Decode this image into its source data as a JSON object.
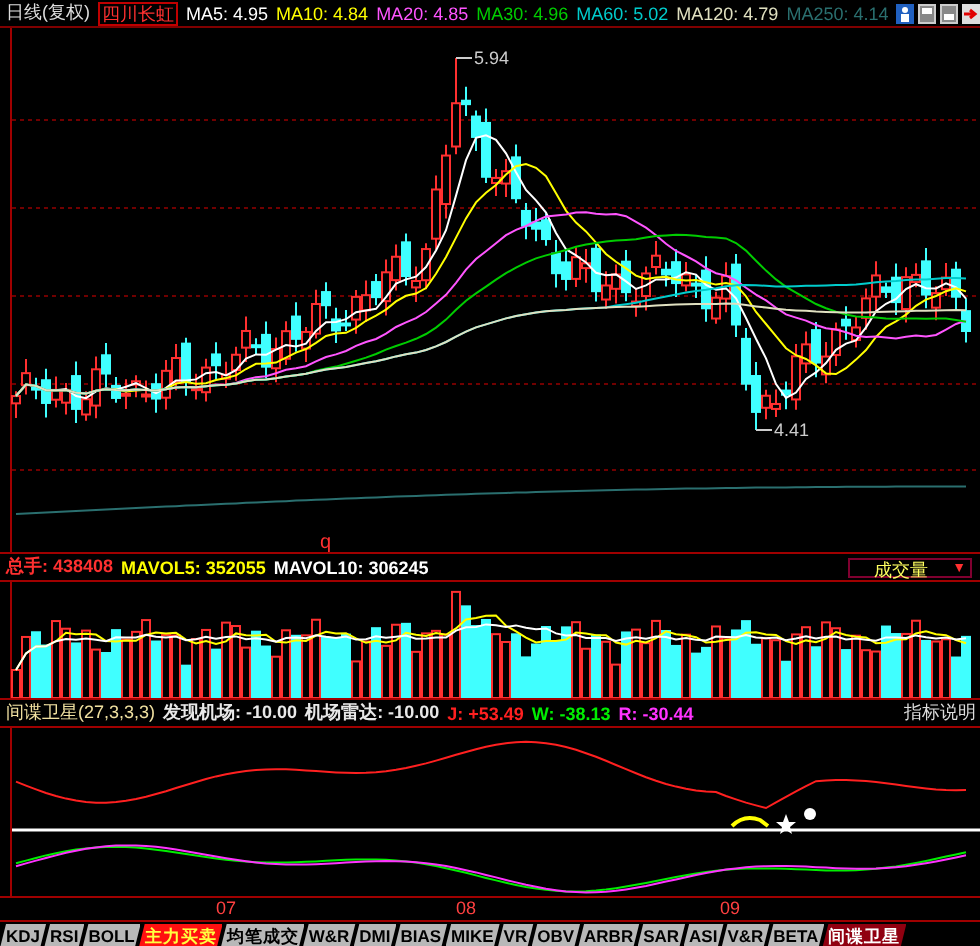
{
  "header": {
    "period": "日线(复权)",
    "stock": "四川长虹",
    "ma": [
      {
        "label": "MA5: 4.95",
        "color": "#ffffff"
      },
      {
        "label": "MA10: 4.84",
        "color": "#ffff00"
      },
      {
        "label": "MA20: 4.85",
        "color": "#ff55ff"
      },
      {
        "label": "MA30: 4.96",
        "color": "#00cc00"
      },
      {
        "label": "MA60: 5.02",
        "color": "#00cccc"
      },
      {
        "label": "MA120: 4.79",
        "color": "#e0e0c0"
      },
      {
        "label": "MA250: 4.14",
        "color": "#2a6f6f"
      }
    ]
  },
  "price_chart": {
    "high_label": "5.94",
    "low_label": "4.41",
    "marker": "q"
  },
  "volume": {
    "legend": [
      {
        "label": "总手: 438408"
      },
      {
        "label": "MAVOL5: 352055",
        "color": "#ffff00"
      },
      {
        "label": "MAVOL10: 306245",
        "color": "#ffffff"
      }
    ],
    "selector": {
      "value": "成交量",
      "arrow": "▼"
    }
  },
  "indicator": {
    "name": "间谍卫星(27,3,3,3)",
    "legend": [
      {
        "label": "发现机场: -10.00"
      },
      {
        "label": "机场雷达: -10.00"
      },
      {
        "label": "J: +53.49",
        "color": "#ff2020"
      },
      {
        "label": "W: -38.13",
        "color": "#00ee00"
      },
      {
        "label": "R: -30.44",
        "color": "#ff33ff"
      }
    ],
    "help": "指标说明"
  },
  "x_axis": [
    "07",
    "08",
    "09"
  ],
  "tabs": [
    {
      "label": "KDJ",
      "selected": false,
      "highlighted": false
    },
    {
      "label": "RSI",
      "selected": false,
      "highlighted": false
    },
    {
      "label": "BOLL",
      "selected": false,
      "highlighted": false
    },
    {
      "label": "主力买卖",
      "selected": false,
      "highlighted": true
    },
    {
      "label": "均笔成交",
      "selected": false,
      "highlighted": false
    },
    {
      "label": "W&R",
      "selected": false,
      "highlighted": false
    },
    {
      "label": "DMI",
      "selected": false,
      "highlighted": false
    },
    {
      "label": "BIAS",
      "selected": false,
      "highlighted": false
    },
    {
      "label": "MIKE",
      "selected": false,
      "highlighted": false
    },
    {
      "label": "VR",
      "selected": false,
      "highlighted": false
    },
    {
      "label": "OBV",
      "selected": false,
      "highlighted": false
    },
    {
      "label": "ARBR",
      "selected": false,
      "highlighted": false
    },
    {
      "label": "SAR",
      "selected": false,
      "highlighted": false
    },
    {
      "label": "ASI",
      "selected": false,
      "highlighted": false
    },
    {
      "label": "V&R",
      "selected": false,
      "highlighted": false
    },
    {
      "label": "BETA",
      "selected": false,
      "highlighted": false
    },
    {
      "label": "间谍卫星",
      "selected": true,
      "highlighted": false
    }
  ]
}
